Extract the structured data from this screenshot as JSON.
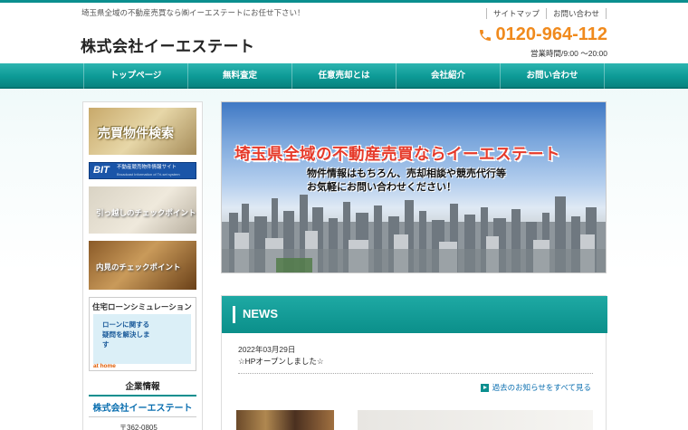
{
  "header": {
    "tagline": "埼玉県全域の不動産売買なら㈱イーエステートにお任せ下さい！",
    "company_name": "株式会社イーエステート",
    "top_links": [
      "サイトマップ",
      "お問い合わせ"
    ],
    "phone": "0120-964-112",
    "hours": "営業時間/9:00 ～20:00",
    "accent_color": "#f08a1d"
  },
  "nav": {
    "items": [
      "トップページ",
      "無料査定",
      "任意売却とは",
      "会社紹介",
      "お問い合わせ"
    ],
    "color": "#0d9a96"
  },
  "sidebar": {
    "banners": {
      "search": "売買物件検索",
      "bit_logo": "BIT",
      "bit_text": "不動産競売物件情報サイト",
      "bit_sub": "Broadcast Information of Tri-set system",
      "moving": "引っ越しのチェックポイント",
      "viewing": "内見のチェックポイント",
      "loan_title": "住宅ローンシミュレーション",
      "loan_bubble": "ローンに関する疑問を解決します",
      "loan_brand": "at home"
    },
    "company_info_heading": "企業情報",
    "company_name": "株式会社イーエステート",
    "zip": "〒362-0805"
  },
  "hero": {
    "title": "埼玉県全域の不動産売買ならイーエステート",
    "subtitle_line1": "物件情報はもちろん、売却相談や競売代行等",
    "subtitle_line2": "お気軽にお問い合わせください！"
  },
  "news": {
    "heading": "NEWS",
    "items": [
      {
        "date": "2022年03月29日",
        "text": "☆HPオープンしました☆"
      }
    ],
    "more_link": "過去のお知らせをすべて見る"
  }
}
